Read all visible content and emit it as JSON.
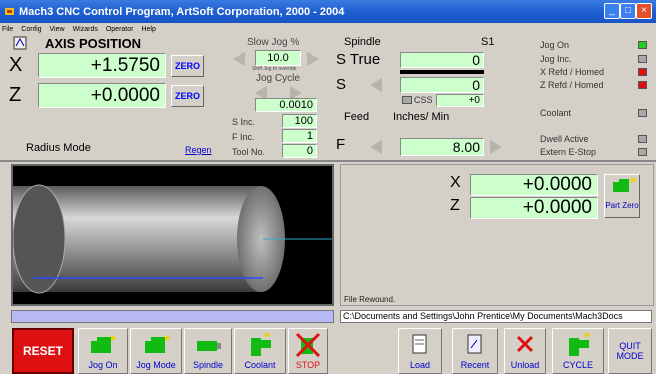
{
  "window": {
    "title": "Mach3 CNC Control Program, ArtSoft Corporation, 2000 - 2004"
  },
  "menu": [
    "File",
    "Config",
    "View",
    "Wizards",
    "Operator",
    "Help"
  ],
  "axis": {
    "heading": "AXIS POSITION",
    "x_label": "X",
    "x_value": "+1.5750",
    "z_label": "Z",
    "z_value": "+0.0000",
    "zero_label": "ZERO",
    "mode": "Radius Mode",
    "regen": "Regen"
  },
  "jog": {
    "slow_label": "Slow Jog %",
    "slow_value": "10.0",
    "shift_hint": "Shift Jog to override",
    "cycle_label": "Jog Cycle",
    "cycle_value": "0.0010",
    "s_inc_label": "S Inc.",
    "s_inc_value": "100",
    "f_inc_label": "F Inc.",
    "f_inc_value": "1",
    "tool_label": "Tool No.",
    "tool_value": "0"
  },
  "spindle": {
    "heading": "Spindle",
    "s1": "S1",
    "true_label": "S True",
    "true_value": "0",
    "s_label": "S",
    "s_value": "0",
    "css_label": "CSS",
    "css_value": "+0",
    "feed_label": "Feed",
    "feed_units": "Inches/ Min",
    "f_label": "F",
    "f_value": "8.00"
  },
  "status": {
    "jog_on": "Jog On",
    "jog_inc": "Jog Inc.",
    "x_ref": "X Refd / Homed",
    "z_ref": "Z Refd / Homed",
    "coolant": "Coolant",
    "dwell": "Dwell Active",
    "estop": "Extern E-Stop",
    "colors": {
      "on": "#22cc22",
      "off": "#a8a8a8",
      "alarm": "#dd1111"
    }
  },
  "part": {
    "x_label": "X",
    "x_value": "+0.0000",
    "z_label": "Z",
    "z_value": "+0.0000",
    "button": "Part Zero",
    "file_status": "File Rewound.",
    "file_path": "C:\\Documents and Settings\\John Prentice\\My Documents\\Mach3Docs"
  },
  "toolbar": {
    "reset": "RESET",
    "jog_on": "Jog On",
    "jog_mode": "Jog Mode",
    "spindle": "Spindle",
    "coolant": "Coolant",
    "stop": "STOP",
    "load": "Load",
    "recent": "Recent",
    "unload": "Unload",
    "cycle": "CYCLE",
    "quit": "QUIT MODE"
  }
}
